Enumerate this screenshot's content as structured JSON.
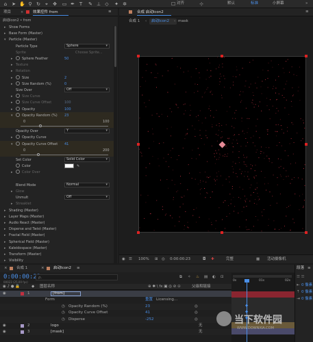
{
  "toolbar": {
    "align_label": "对齐",
    "workspace_default": "默认",
    "workspace_standard": "标准",
    "workspace_small_screen": "小屏幕",
    "more": "»"
  },
  "project_tab": "项目",
  "effect_controls_tab": "效果控件 from",
  "effect_path": "启动Icon2 • from",
  "effect_rows": [
    {
      "type": "group",
      "twirl": "▸",
      "label": "Show Forms",
      "dim": false,
      "indent": 0,
      "sw": false
    },
    {
      "type": "group",
      "twirl": "▸",
      "label": "Base Form (Master)",
      "dim": false,
      "indent": 0,
      "sw": false
    },
    {
      "type": "group",
      "twirl": "▾",
      "label": "Particle (Master)",
      "dim": false,
      "indent": 0,
      "sw": false
    },
    {
      "type": "dropdown",
      "twirl": "",
      "label": "Particle Type",
      "value": "Sphere",
      "indent": 1,
      "sw": false
    },
    {
      "type": "text",
      "twirl": "",
      "label": "Sprite",
      "value": "Choose Sprite...",
      "dim": true,
      "indent": 1,
      "sw": false
    },
    {
      "type": "num",
      "twirl": "▸",
      "label": "Sphere Feather",
      "value": "50",
      "indent": 1,
      "sw": true
    },
    {
      "type": "group",
      "twirl": "▸",
      "label": "Texture",
      "dim": true,
      "indent": 1,
      "sw": false
    },
    {
      "type": "group",
      "twirl": "▸",
      "label": "Rotation",
      "dim": true,
      "indent": 1,
      "sw": false
    },
    {
      "type": "num",
      "twirl": "▸",
      "label": "Size",
      "value": "2",
      "indent": 1,
      "sw": true
    },
    {
      "type": "num",
      "twirl": "▸",
      "label": "Size Random (%)",
      "value": "0",
      "indent": 1,
      "sw": true
    },
    {
      "type": "dropdown",
      "twirl": "",
      "label": "Size Over",
      "value": "Off",
      "indent": 1,
      "sw": false
    },
    {
      "type": "group",
      "twirl": "▸",
      "label": "Size Curve",
      "dim": true,
      "indent": 1,
      "sw": true
    },
    {
      "type": "num",
      "twirl": "▸",
      "label": "Size Curve Offset",
      "value": "100",
      "dim": true,
      "indent": 1,
      "sw": true
    },
    {
      "type": "num",
      "twirl": "▸",
      "label": "Opacity",
      "value": "100",
      "indent": 1,
      "sw": true
    },
    {
      "type": "num",
      "twirl": "▾",
      "label": "Opacity Random (%)",
      "value": "23",
      "indent": 1,
      "sw": true,
      "hl": true
    },
    {
      "type": "slider",
      "min": "0",
      "max": "100",
      "level": 0.23,
      "hl": true
    },
    {
      "type": "dropdown",
      "twirl": "",
      "label": "Opacity Over",
      "value": "Y",
      "indent": 1,
      "sw": false
    },
    {
      "type": "group",
      "twirl": "▸",
      "label": "Opacity Curve",
      "dim": false,
      "indent": 1,
      "sw": true
    },
    {
      "type": "num",
      "twirl": "▾",
      "label": "Opacity Curve Offset",
      "value": "41",
      "indent": 1,
      "sw": true,
      "hl": true
    },
    {
      "type": "slider",
      "min": "0",
      "max": "200",
      "level": 0.205,
      "hl": true
    },
    {
      "type": "dropdown",
      "twirl": "",
      "label": "Set Color",
      "value": "Solid Color",
      "indent": 1,
      "sw": false
    },
    {
      "type": "color",
      "twirl": "",
      "label": "Color",
      "indent": 1,
      "sw": true
    },
    {
      "type": "group",
      "twirl": "▸",
      "label": "Color Over",
      "dim": true,
      "indent": 1,
      "sw": true
    },
    {
      "type": "spacer"
    },
    {
      "type": "dropdown",
      "twirl": "",
      "label": "Blend Mode",
      "value": "Normal",
      "indent": 1,
      "sw": false
    },
    {
      "type": "group",
      "twirl": "▸",
      "label": "Glow",
      "dim": true,
      "indent": 1,
      "sw": false
    },
    {
      "type": "dropdown",
      "twirl": "",
      "label": "Unmult",
      "value": "Off",
      "indent": 1,
      "sw": false
    },
    {
      "type": "group",
      "twirl": "▸",
      "label": "Streaklet",
      "dim": true,
      "indent": 1,
      "sw": false
    },
    {
      "type": "group",
      "twirl": "▸",
      "label": "Shading (Master)",
      "dim": false,
      "indent": 0,
      "sw": false
    },
    {
      "type": "group",
      "twirl": "▸",
      "label": "Layer Maps (Master)",
      "dim": false,
      "indent": 0,
      "sw": false
    },
    {
      "type": "group",
      "twirl": "▸",
      "label": "Audio React (Master)",
      "dim": false,
      "indent": 0,
      "sw": false
    },
    {
      "type": "group",
      "twirl": "▸",
      "label": "Disperse and Twist (Master)",
      "dim": false,
      "indent": 0,
      "sw": false
    },
    {
      "type": "group",
      "twirl": "▸",
      "label": "Fractal Field (Master)",
      "dim": false,
      "indent": 0,
      "sw": false
    },
    {
      "type": "group",
      "twirl": "▸",
      "label": "Spherical Field (Master)",
      "dim": false,
      "indent": 0,
      "sw": false
    },
    {
      "type": "group",
      "twirl": "▸",
      "label": "Kaleidospace (Master)",
      "dim": false,
      "indent": 0,
      "sw": false
    },
    {
      "type": "group",
      "twirl": "▸",
      "label": "Transform (Master)",
      "dim": false,
      "indent": 0,
      "sw": false
    },
    {
      "type": "group",
      "twirl": "▸",
      "label": "Visibility",
      "dim": false,
      "indent": 0,
      "sw": false
    }
  ],
  "comp": {
    "panel_title": "合成 启动Icon2",
    "breadcrumb_1": "合成 1",
    "breadcrumb_2": "启动Icon2",
    "breadcrumb_3": "mask",
    "zoom": "100%",
    "timecode": "0:00:00:23",
    "resolution": "完整",
    "camera": "活动摄像机"
  },
  "timeline": {
    "tab_1": "合成 1",
    "tab_2": "启动Icon2",
    "timecode": "0:00:00:23",
    "frames": "00023 (25.00 fps)",
    "search_placeholder": "ρ.",
    "col_layer_name": "图层名称",
    "col_parent": "父级和链接",
    "rows": [
      {
        "num": "1",
        "name": "[from]",
        "selected": true,
        "mode": "",
        "parent": ""
      },
      {
        "num": "",
        "name": "Form",
        "selected": false,
        "mode": "重置",
        "parent": "Licensing..."
      },
      {
        "num": "",
        "name": "Opacity Random (%)",
        "selected": false,
        "mode": "23",
        "parent": ""
      },
      {
        "num": "",
        "name": "Opacity Curve Offset",
        "selected": false,
        "mode": "41",
        "parent": ""
      },
      {
        "num": "",
        "name": "Disperse",
        "selected": false,
        "mode": "-252",
        "parent": ""
      },
      {
        "num": "2",
        "name": "logo",
        "selected": false,
        "mode": "",
        "parent": "无"
      },
      {
        "num": "3",
        "name": "[mask]",
        "selected": false,
        "mode": "",
        "parent": "无"
      }
    ],
    "ruler": [
      "0s",
      "01s",
      "02s"
    ]
  },
  "right_panel": {
    "title": "段落",
    "values": [
      "0 像素",
      "0 像素",
      "0 像素"
    ]
  },
  "watermark": "当下软件园",
  "watermark_url": "WWW.DOWNXIA.COM",
  "colors": {
    "accent": "#4a8fe8",
    "handle": "#d22222",
    "particle": "#c0303f"
  }
}
